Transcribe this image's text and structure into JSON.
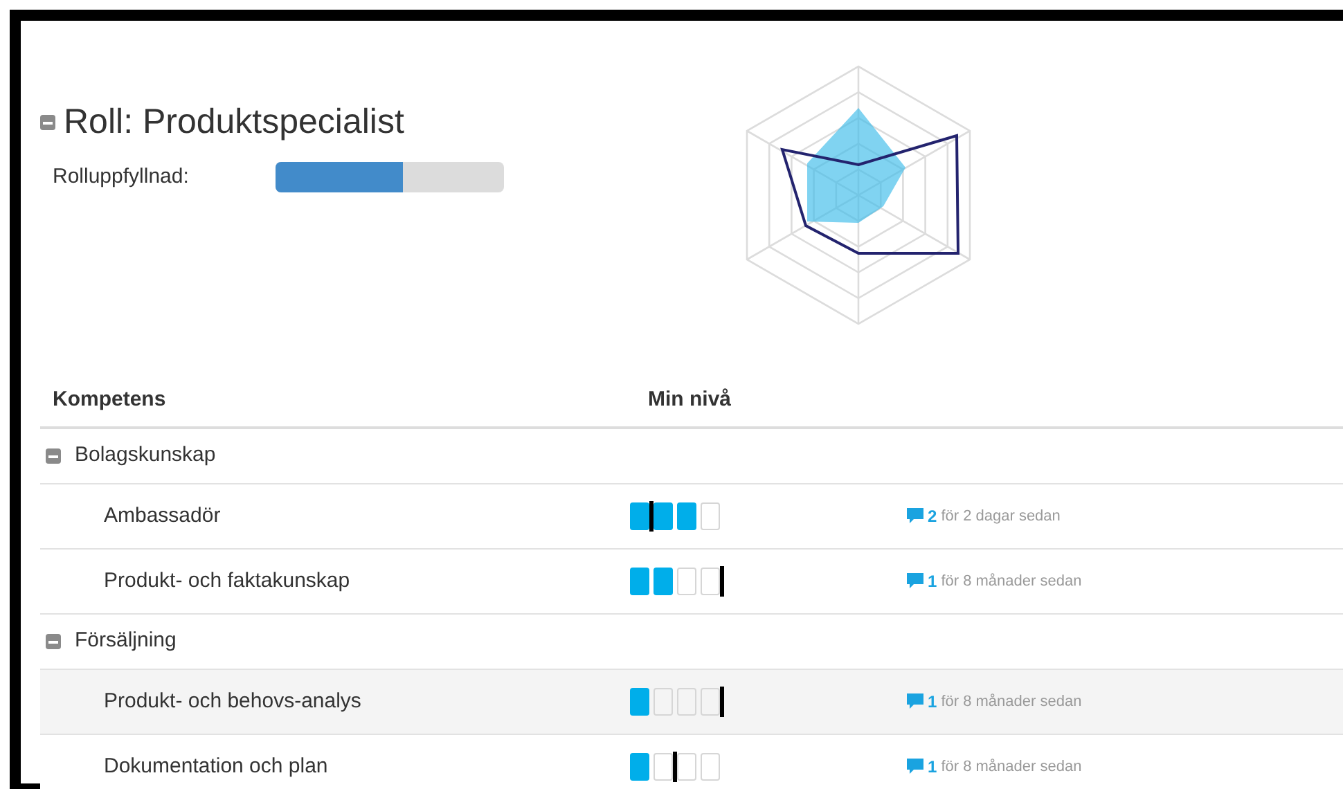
{
  "role": {
    "title": "Roll: Produktspecialist",
    "expanded": true,
    "fulfilment": {
      "label": "Rolluppfyllnad:",
      "level": 0.56
    }
  },
  "table": {
    "columns": [
      "Kompetens",
      "Min nivå"
    ],
    "groups": [
      {
        "name": "Bolagskunskap",
        "expanded": true,
        "children": [
          {
            "name": "Ambassadör",
            "selected": false,
            "segments": [
              {
                "filled": true,
                "target": true
              },
              {
                "filled": true,
                "target": false
              },
              {
                "filled": true,
                "target": false
              },
              {
                "filled": false,
                "target": false
              }
            ],
            "comments": "2",
            "time": "för 2 dagar sedan"
          },
          {
            "name": "Produkt- och faktakunskap",
            "selected": false,
            "segments": [
              {
                "filled": true,
                "target": false
              },
              {
                "filled": true,
                "target": false
              },
              {
                "filled": false,
                "target": false
              },
              {
                "filled": false,
                "target": true
              }
            ],
            "comments": "1",
            "time": "för 8 månader sedan"
          }
        ]
      },
      {
        "name": "Försäljning",
        "expanded": true,
        "children": [
          {
            "name": "Produkt- och behovs-analys",
            "selected": true,
            "segments": [
              {
                "filled": true,
                "target": false
              },
              {
                "filled": false,
                "target": false
              },
              {
                "filled": false,
                "target": false
              },
              {
                "filled": false,
                "target": true
              }
            ],
            "comments": "1",
            "time": "för 8 månader sedan"
          },
          {
            "name": "Dokumentation och plan",
            "selected": false,
            "segments": [
              {
                "filled": true,
                "target": false
              },
              {
                "filled": false,
                "target": true
              },
              {
                "filled": false,
                "target": false
              },
              {
                "filled": false,
                "target": false
              }
            ],
            "comments": "1",
            "time": "för 8 månader sedan"
          }
        ]
      }
    ]
  }
}
